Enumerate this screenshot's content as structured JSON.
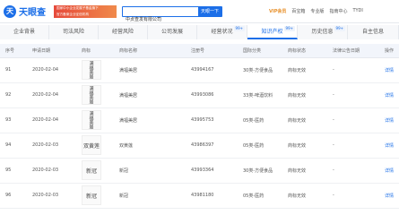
{
  "header": {
    "logo_mark": "天",
    "logo_text": "天眼查",
    "ad_line1": "国家中小企业发展子基金旗下",
    "ad_line2": "官方备案企业征信机构",
    "search_value": "中贞查发有限公司",
    "search_button": "天眼一下",
    "links": [
      "VIP会员",
      "百宝箱",
      "专业版",
      "指南中心",
      "TYDI"
    ]
  },
  "tabs": [
    {
      "label": "企业背景",
      "badge": ""
    },
    {
      "label": "司法风险",
      "badge": ""
    },
    {
      "label": "经营风险",
      "badge": ""
    },
    {
      "label": "公司发展",
      "badge": ""
    },
    {
      "label": "经营状况",
      "badge": "99+"
    },
    {
      "label": "知识产权",
      "badge": "99+"
    },
    {
      "label": "历史信息",
      "badge": "99+"
    },
    {
      "label": "自主信息",
      "badge": ""
    }
  ],
  "table": {
    "columns": [
      "序号",
      "申请日期",
      "商标",
      "商标名称",
      "注册号",
      "国际分类",
      "商标状态",
      "法律公告日期",
      "操作"
    ],
    "rows": [
      {
        "no": "91",
        "date": "2020-02-04",
        "img": "满福美居",
        "name": "满福美居",
        "reg": "43994167",
        "cls": "30类-方便食品",
        "status": "商标无效",
        "notice": "-",
        "op": "详情"
      },
      {
        "no": "92",
        "date": "2020-02-04",
        "img": "满福美居",
        "name": "满福美居",
        "reg": "43993086",
        "cls": "33类-啤酒饮料",
        "status": "商标无效",
        "notice": "-",
        "op": "详情"
      },
      {
        "no": "93",
        "date": "2020-02-04",
        "img": "满福美居",
        "name": "满福美居",
        "reg": "43995753",
        "cls": "05类-医药",
        "status": "商标无效",
        "notice": "-",
        "op": "详情"
      },
      {
        "no": "94",
        "date": "2020-02-03",
        "img": "双黄莲",
        "name": "双黄莲",
        "reg": "43986397",
        "cls": "05类-医药",
        "status": "商标无效",
        "notice": "-",
        "op": "详情"
      },
      {
        "no": "95",
        "date": "2020-02-03",
        "img": "新冠",
        "name": "新冠",
        "reg": "43993364",
        "cls": "30类-方便食品",
        "status": "商标无效",
        "notice": "-",
        "op": "详情"
      },
      {
        "no": "96",
        "date": "2020-02-03",
        "img": "新冠",
        "name": "新冠",
        "reg": "43981180",
        "cls": "05类-医药",
        "status": "商标无效",
        "notice": "-",
        "op": "详情"
      }
    ]
  }
}
